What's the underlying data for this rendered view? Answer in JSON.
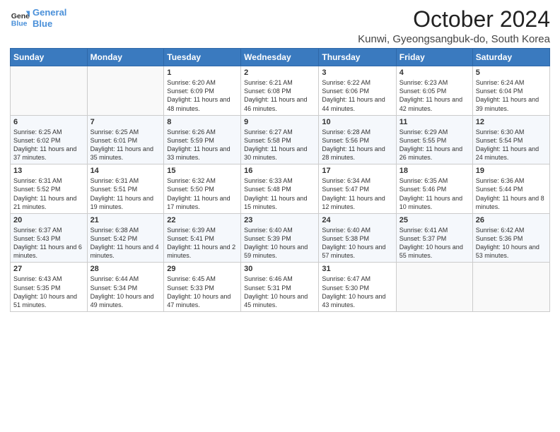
{
  "header": {
    "logo_line1": "General",
    "logo_line2": "Blue",
    "main_title": "October 2024",
    "subtitle": "Kunwi, Gyeongsangbuk-do, South Korea"
  },
  "weekdays": [
    "Sunday",
    "Monday",
    "Tuesday",
    "Wednesday",
    "Thursday",
    "Friday",
    "Saturday"
  ],
  "weeks": [
    [
      {
        "day": "",
        "sunrise": "",
        "sunset": "",
        "daylight": ""
      },
      {
        "day": "",
        "sunrise": "",
        "sunset": "",
        "daylight": ""
      },
      {
        "day": "1",
        "sunrise": "Sunrise: 6:20 AM",
        "sunset": "Sunset: 6:09 PM",
        "daylight": "Daylight: 11 hours and 48 minutes."
      },
      {
        "day": "2",
        "sunrise": "Sunrise: 6:21 AM",
        "sunset": "Sunset: 6:08 PM",
        "daylight": "Daylight: 11 hours and 46 minutes."
      },
      {
        "day": "3",
        "sunrise": "Sunrise: 6:22 AM",
        "sunset": "Sunset: 6:06 PM",
        "daylight": "Daylight: 11 hours and 44 minutes."
      },
      {
        "day": "4",
        "sunrise": "Sunrise: 6:23 AM",
        "sunset": "Sunset: 6:05 PM",
        "daylight": "Daylight: 11 hours and 42 minutes."
      },
      {
        "day": "5",
        "sunrise": "Sunrise: 6:24 AM",
        "sunset": "Sunset: 6:04 PM",
        "daylight": "Daylight: 11 hours and 39 minutes."
      }
    ],
    [
      {
        "day": "6",
        "sunrise": "Sunrise: 6:25 AM",
        "sunset": "Sunset: 6:02 PM",
        "daylight": "Daylight: 11 hours and 37 minutes."
      },
      {
        "day": "7",
        "sunrise": "Sunrise: 6:25 AM",
        "sunset": "Sunset: 6:01 PM",
        "daylight": "Daylight: 11 hours and 35 minutes."
      },
      {
        "day": "8",
        "sunrise": "Sunrise: 6:26 AM",
        "sunset": "Sunset: 5:59 PM",
        "daylight": "Daylight: 11 hours and 33 minutes."
      },
      {
        "day": "9",
        "sunrise": "Sunrise: 6:27 AM",
        "sunset": "Sunset: 5:58 PM",
        "daylight": "Daylight: 11 hours and 30 minutes."
      },
      {
        "day": "10",
        "sunrise": "Sunrise: 6:28 AM",
        "sunset": "Sunset: 5:56 PM",
        "daylight": "Daylight: 11 hours and 28 minutes."
      },
      {
        "day": "11",
        "sunrise": "Sunrise: 6:29 AM",
        "sunset": "Sunset: 5:55 PM",
        "daylight": "Daylight: 11 hours and 26 minutes."
      },
      {
        "day": "12",
        "sunrise": "Sunrise: 6:30 AM",
        "sunset": "Sunset: 5:54 PM",
        "daylight": "Daylight: 11 hours and 24 minutes."
      }
    ],
    [
      {
        "day": "13",
        "sunrise": "Sunrise: 6:31 AM",
        "sunset": "Sunset: 5:52 PM",
        "daylight": "Daylight: 11 hours and 21 minutes."
      },
      {
        "day": "14",
        "sunrise": "Sunrise: 6:31 AM",
        "sunset": "Sunset: 5:51 PM",
        "daylight": "Daylight: 11 hours and 19 minutes."
      },
      {
        "day": "15",
        "sunrise": "Sunrise: 6:32 AM",
        "sunset": "Sunset: 5:50 PM",
        "daylight": "Daylight: 11 hours and 17 minutes."
      },
      {
        "day": "16",
        "sunrise": "Sunrise: 6:33 AM",
        "sunset": "Sunset: 5:48 PM",
        "daylight": "Daylight: 11 hours and 15 minutes."
      },
      {
        "day": "17",
        "sunrise": "Sunrise: 6:34 AM",
        "sunset": "Sunset: 5:47 PM",
        "daylight": "Daylight: 11 hours and 12 minutes."
      },
      {
        "day": "18",
        "sunrise": "Sunrise: 6:35 AM",
        "sunset": "Sunset: 5:46 PM",
        "daylight": "Daylight: 11 hours and 10 minutes."
      },
      {
        "day": "19",
        "sunrise": "Sunrise: 6:36 AM",
        "sunset": "Sunset: 5:44 PM",
        "daylight": "Daylight: 11 hours and 8 minutes."
      }
    ],
    [
      {
        "day": "20",
        "sunrise": "Sunrise: 6:37 AM",
        "sunset": "Sunset: 5:43 PM",
        "daylight": "Daylight: 11 hours and 6 minutes."
      },
      {
        "day": "21",
        "sunrise": "Sunrise: 6:38 AM",
        "sunset": "Sunset: 5:42 PM",
        "daylight": "Daylight: 11 hours and 4 minutes."
      },
      {
        "day": "22",
        "sunrise": "Sunrise: 6:39 AM",
        "sunset": "Sunset: 5:41 PM",
        "daylight": "Daylight: 11 hours and 2 minutes."
      },
      {
        "day": "23",
        "sunrise": "Sunrise: 6:40 AM",
        "sunset": "Sunset: 5:39 PM",
        "daylight": "Daylight: 10 hours and 59 minutes."
      },
      {
        "day": "24",
        "sunrise": "Sunrise: 6:40 AM",
        "sunset": "Sunset: 5:38 PM",
        "daylight": "Daylight: 10 hours and 57 minutes."
      },
      {
        "day": "25",
        "sunrise": "Sunrise: 6:41 AM",
        "sunset": "Sunset: 5:37 PM",
        "daylight": "Daylight: 10 hours and 55 minutes."
      },
      {
        "day": "26",
        "sunrise": "Sunrise: 6:42 AM",
        "sunset": "Sunset: 5:36 PM",
        "daylight": "Daylight: 10 hours and 53 minutes."
      }
    ],
    [
      {
        "day": "27",
        "sunrise": "Sunrise: 6:43 AM",
        "sunset": "Sunset: 5:35 PM",
        "daylight": "Daylight: 10 hours and 51 minutes."
      },
      {
        "day": "28",
        "sunrise": "Sunrise: 6:44 AM",
        "sunset": "Sunset: 5:34 PM",
        "daylight": "Daylight: 10 hours and 49 minutes."
      },
      {
        "day": "29",
        "sunrise": "Sunrise: 6:45 AM",
        "sunset": "Sunset: 5:33 PM",
        "daylight": "Daylight: 10 hours and 47 minutes."
      },
      {
        "day": "30",
        "sunrise": "Sunrise: 6:46 AM",
        "sunset": "Sunset: 5:31 PM",
        "daylight": "Daylight: 10 hours and 45 minutes."
      },
      {
        "day": "31",
        "sunrise": "Sunrise: 6:47 AM",
        "sunset": "Sunset: 5:30 PM",
        "daylight": "Daylight: 10 hours and 43 minutes."
      },
      {
        "day": "",
        "sunrise": "",
        "sunset": "",
        "daylight": ""
      },
      {
        "day": "",
        "sunrise": "",
        "sunset": "",
        "daylight": ""
      }
    ]
  ]
}
